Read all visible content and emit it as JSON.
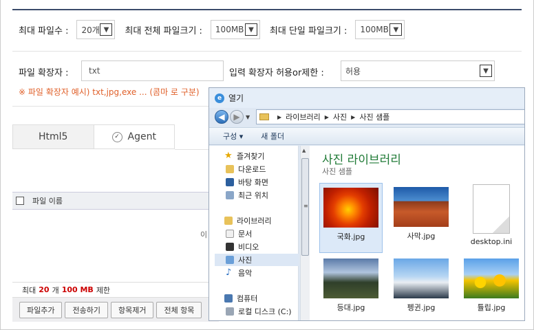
{
  "settings": {
    "max_files_label": "최대 파일수 :",
    "max_files_value": "20개",
    "max_total_label": "최대 전체 파일크기 :",
    "max_total_value": "100MB",
    "max_single_label": "최대 단일 파일크기 :",
    "max_single_value": "100MB",
    "ext_label": "파일 확장자 :",
    "ext_value": "txt",
    "mode_label": "입력 확장자 허용or제한 :",
    "mode_value": "허용",
    "ext_note": "※ 파일 확장자 예시) txt,jpg,exe ... (콤마 로 구분)"
  },
  "tabs": [
    {
      "label": "Html5"
    },
    {
      "label": "Agent"
    }
  ],
  "file_list": {
    "header": "파일 이름",
    "empty_fragment": "이",
    "status_prefix": "최대",
    "status_count": "20",
    "status_count_unit": "개",
    "status_size": "100 MB",
    "status_suffix": "제한"
  },
  "buttons": {
    "add": "파일추가",
    "send": "전송하기",
    "remove": "항목제거",
    "remove_all": "전체 항목"
  },
  "dialog": {
    "title": "열기",
    "path": [
      "라이브러리",
      "사진",
      "사진 샘플"
    ],
    "toolbar": {
      "organize": "구성 ▾",
      "new_folder": "새 폴더"
    },
    "nav": {
      "favorites": "즐겨찾기",
      "downloads": "다운로드",
      "desktop": "바탕 화면",
      "recent": "최근 위치",
      "libraries": "라이브러리",
      "documents": "문서",
      "videos": "비디오",
      "pictures": "사진",
      "music": "음악",
      "computer": "컴퓨터",
      "local_disk": "로컬 디스크 (C:)"
    },
    "library_title": "사진 라이브러리",
    "library_sub": "사진 샘플",
    "files": [
      {
        "name": "국화.jpg",
        "kind": "chrysanthemum"
      },
      {
        "name": "사막.jpg",
        "kind": "desert"
      },
      {
        "name": "desktop.ini",
        "kind": "document"
      },
      {
        "name": "등대.jpg",
        "kind": "lighthouse"
      },
      {
        "name": "펭귄.jpg",
        "kind": "penguins"
      },
      {
        "name": "튤립.jpg",
        "kind": "tulips"
      }
    ]
  },
  "icons": {
    "dropdown": "chevron-down-icon",
    "check": "check-circle-icon",
    "back": "back-arrow-icon",
    "forward": "forward-arrow-icon"
  }
}
